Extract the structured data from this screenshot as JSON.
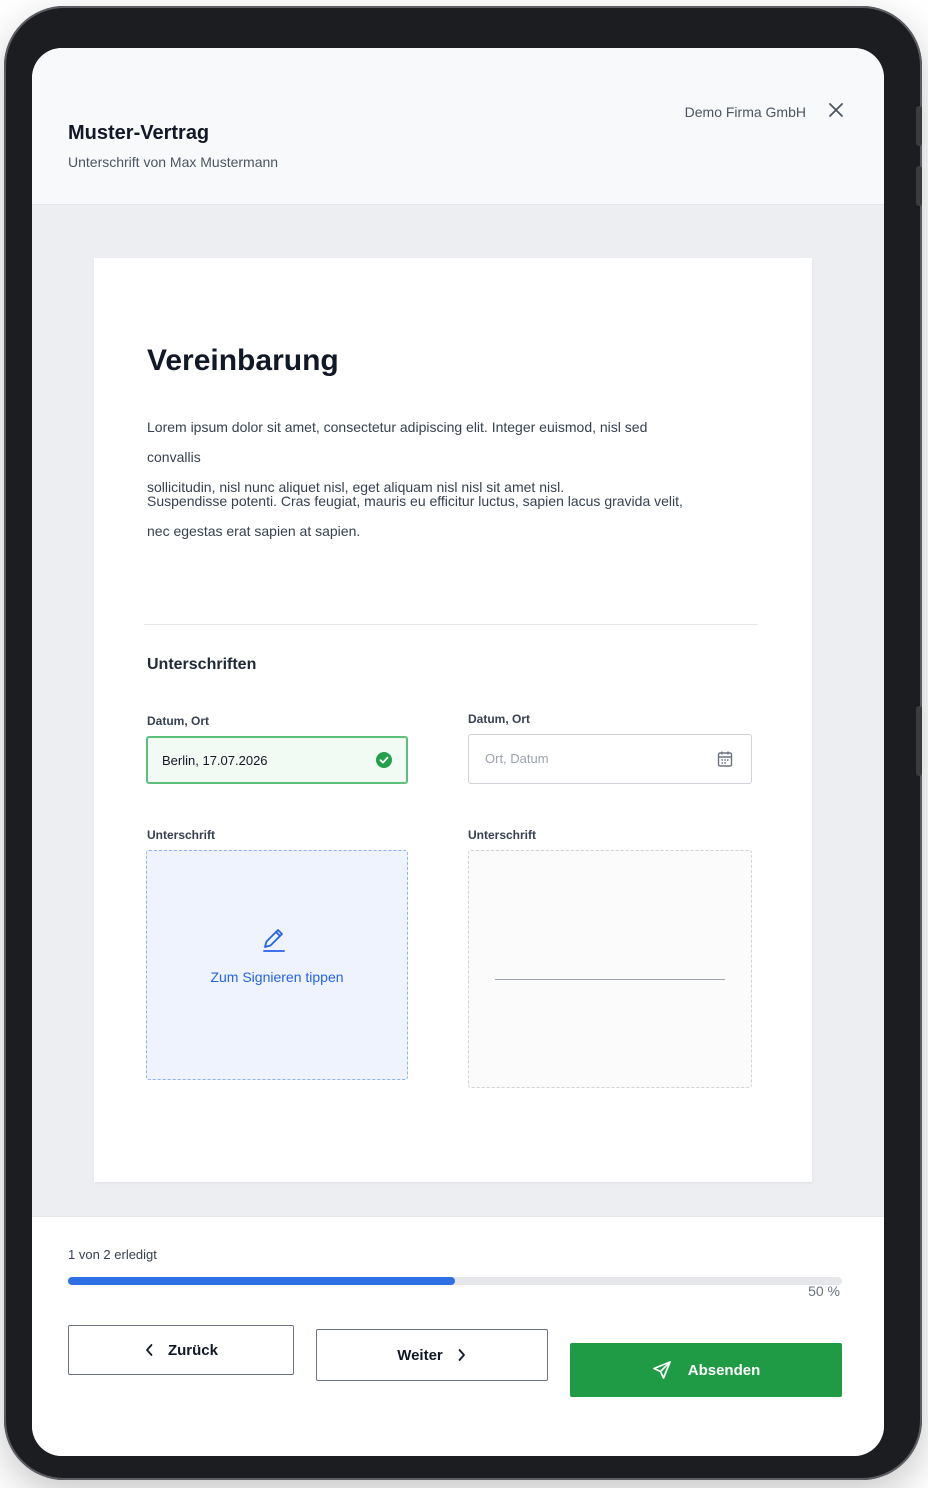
{
  "header": {
    "title": "Muster-Vertrag",
    "subtitle": "Unterschrift von Max Mustermann",
    "company": "Demo Firma GmbH",
    "close_icon": "close-icon"
  },
  "document": {
    "heading": "Vereinbarung",
    "paragraph_1_line_1": "Lorem ipsum dolor sit amet, consectetur adipiscing elit. Integer euismod, nisl sed convallis",
    "paragraph_1_line_2": "sollicitudin, nisl nunc aliquet nisl, eget aliquam nisl nisl sit amet nisl.",
    "paragraph_2_line_1": "Suspendisse potenti. Cras feugiat, mauris eu efficitur luctus, sapien lacus gravida velit,",
    "paragraph_2_line_2": "nec egestas erat sapien at sapien.",
    "signatures_title": "Unterschriften"
  },
  "signer_1": {
    "date_label": "Datum, Ort",
    "date_value": "Berlin, 17.07.2026",
    "date_status_icon": "check-circle-icon",
    "signature_label": "Unterschrift",
    "signature_cta": "Zum Signieren tippen",
    "signature_icon": "pen-icon"
  },
  "signer_2": {
    "date_label": "Datum, Ort",
    "date_placeholder": "Ort, Datum",
    "date_icon": "calendar-icon",
    "signature_label": "Unterschrift"
  },
  "footer": {
    "progress_text": "1 von 2 erledigt",
    "progress_percent_label": "50 %",
    "progress_fraction": 0.5,
    "back_label": "Zurück",
    "next_label": "Weiter",
    "submit_label": "Absenden"
  },
  "colors": {
    "accent_blue": "#2f6fe4",
    "success_green": "#1f9a45",
    "bezel": "#1c1d20"
  }
}
